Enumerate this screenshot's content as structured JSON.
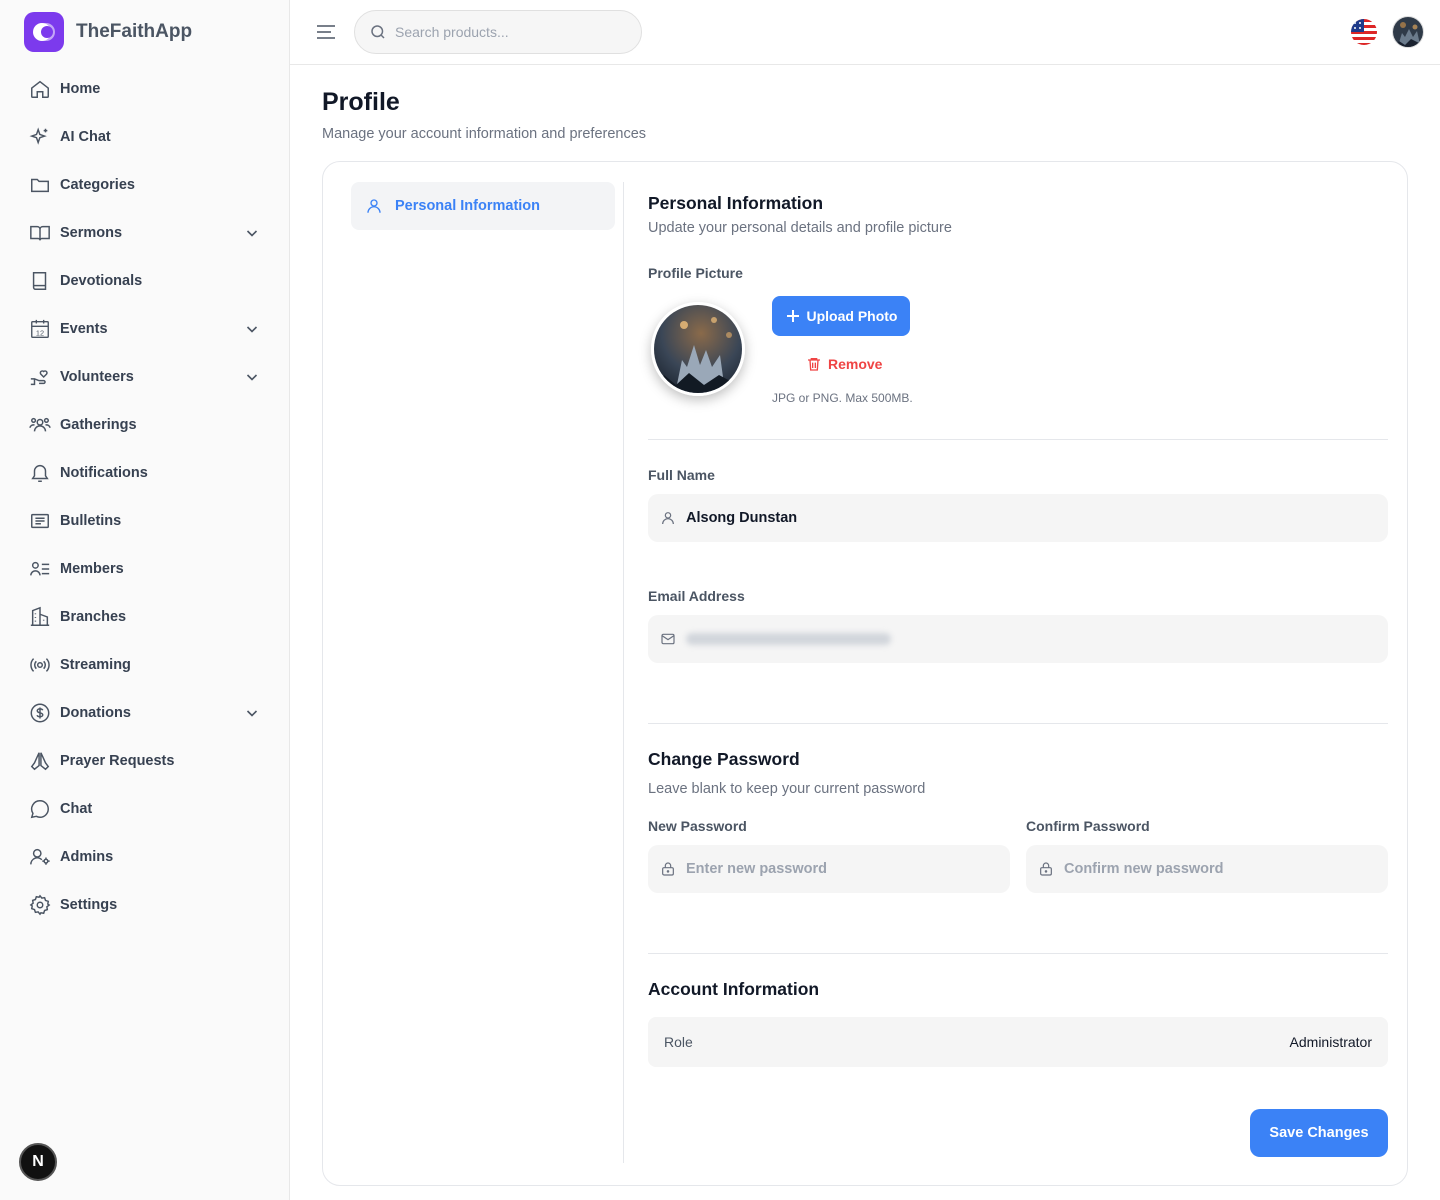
{
  "brand": {
    "name": "TheFaithApp",
    "accent": "#7c3aed"
  },
  "sidebar": {
    "items": [
      {
        "label": "Home",
        "icon": "home-icon"
      },
      {
        "label": "AI Chat",
        "icon": "sparkles-icon"
      },
      {
        "label": "Categories",
        "icon": "folder-icon"
      },
      {
        "label": "Sermons",
        "icon": "book-open-icon",
        "expandable": true
      },
      {
        "label": "Devotionals",
        "icon": "book-icon"
      },
      {
        "label": "Events",
        "icon": "calendar-icon",
        "expandable": true
      },
      {
        "label": "Volunteers",
        "icon": "hand-heart-icon",
        "expandable": true
      },
      {
        "label": "Gatherings",
        "icon": "users-icon"
      },
      {
        "label": "Notifications",
        "icon": "bell-icon"
      },
      {
        "label": "Bulletins",
        "icon": "newspaper-icon"
      },
      {
        "label": "Members",
        "icon": "user-list-icon"
      },
      {
        "label": "Branches",
        "icon": "building-icon"
      },
      {
        "label": "Streaming",
        "icon": "broadcast-icon"
      },
      {
        "label": "Donations",
        "icon": "dollar-circle-icon",
        "expandable": true
      },
      {
        "label": "Prayer Requests",
        "icon": "praying-hands-icon"
      },
      {
        "label": "Chat",
        "icon": "message-circle-icon"
      },
      {
        "label": "Admins",
        "icon": "user-cog-icon"
      },
      {
        "label": "Settings",
        "icon": "gear-icon"
      }
    ],
    "calendar_day": "12",
    "dev_badge": "N"
  },
  "topbar": {
    "search_placeholder": "Search products...",
    "language_icon": "us-flag-icon"
  },
  "page": {
    "title": "Profile",
    "subtitle": "Manage your account information and preferences"
  },
  "tabs": [
    {
      "label": "Personal Information",
      "active": true
    }
  ],
  "personal": {
    "title": "Personal Information",
    "subtitle": "Update your personal details and profile picture",
    "picture_label": "Profile Picture",
    "upload_label": "Upload Photo",
    "remove_label": "Remove",
    "hint": "JPG or PNG. Max 500MB.",
    "full_name_label": "Full Name",
    "full_name_value": "Alsong Dunstan",
    "email_label": "Email Address",
    "email_value": ""
  },
  "password": {
    "title": "Change Password",
    "subtitle": "Leave blank to keep your current password",
    "new_label": "New Password",
    "new_placeholder": "Enter new password",
    "confirm_label": "Confirm Password",
    "confirm_placeholder": "Confirm new password"
  },
  "account": {
    "title": "Account Information",
    "role_label": "Role",
    "role_value": "Administrator"
  },
  "actions": {
    "save_label": "Save Changes"
  },
  "colors": {
    "primary": "#3b82f6",
    "danger": "#ef4444"
  }
}
